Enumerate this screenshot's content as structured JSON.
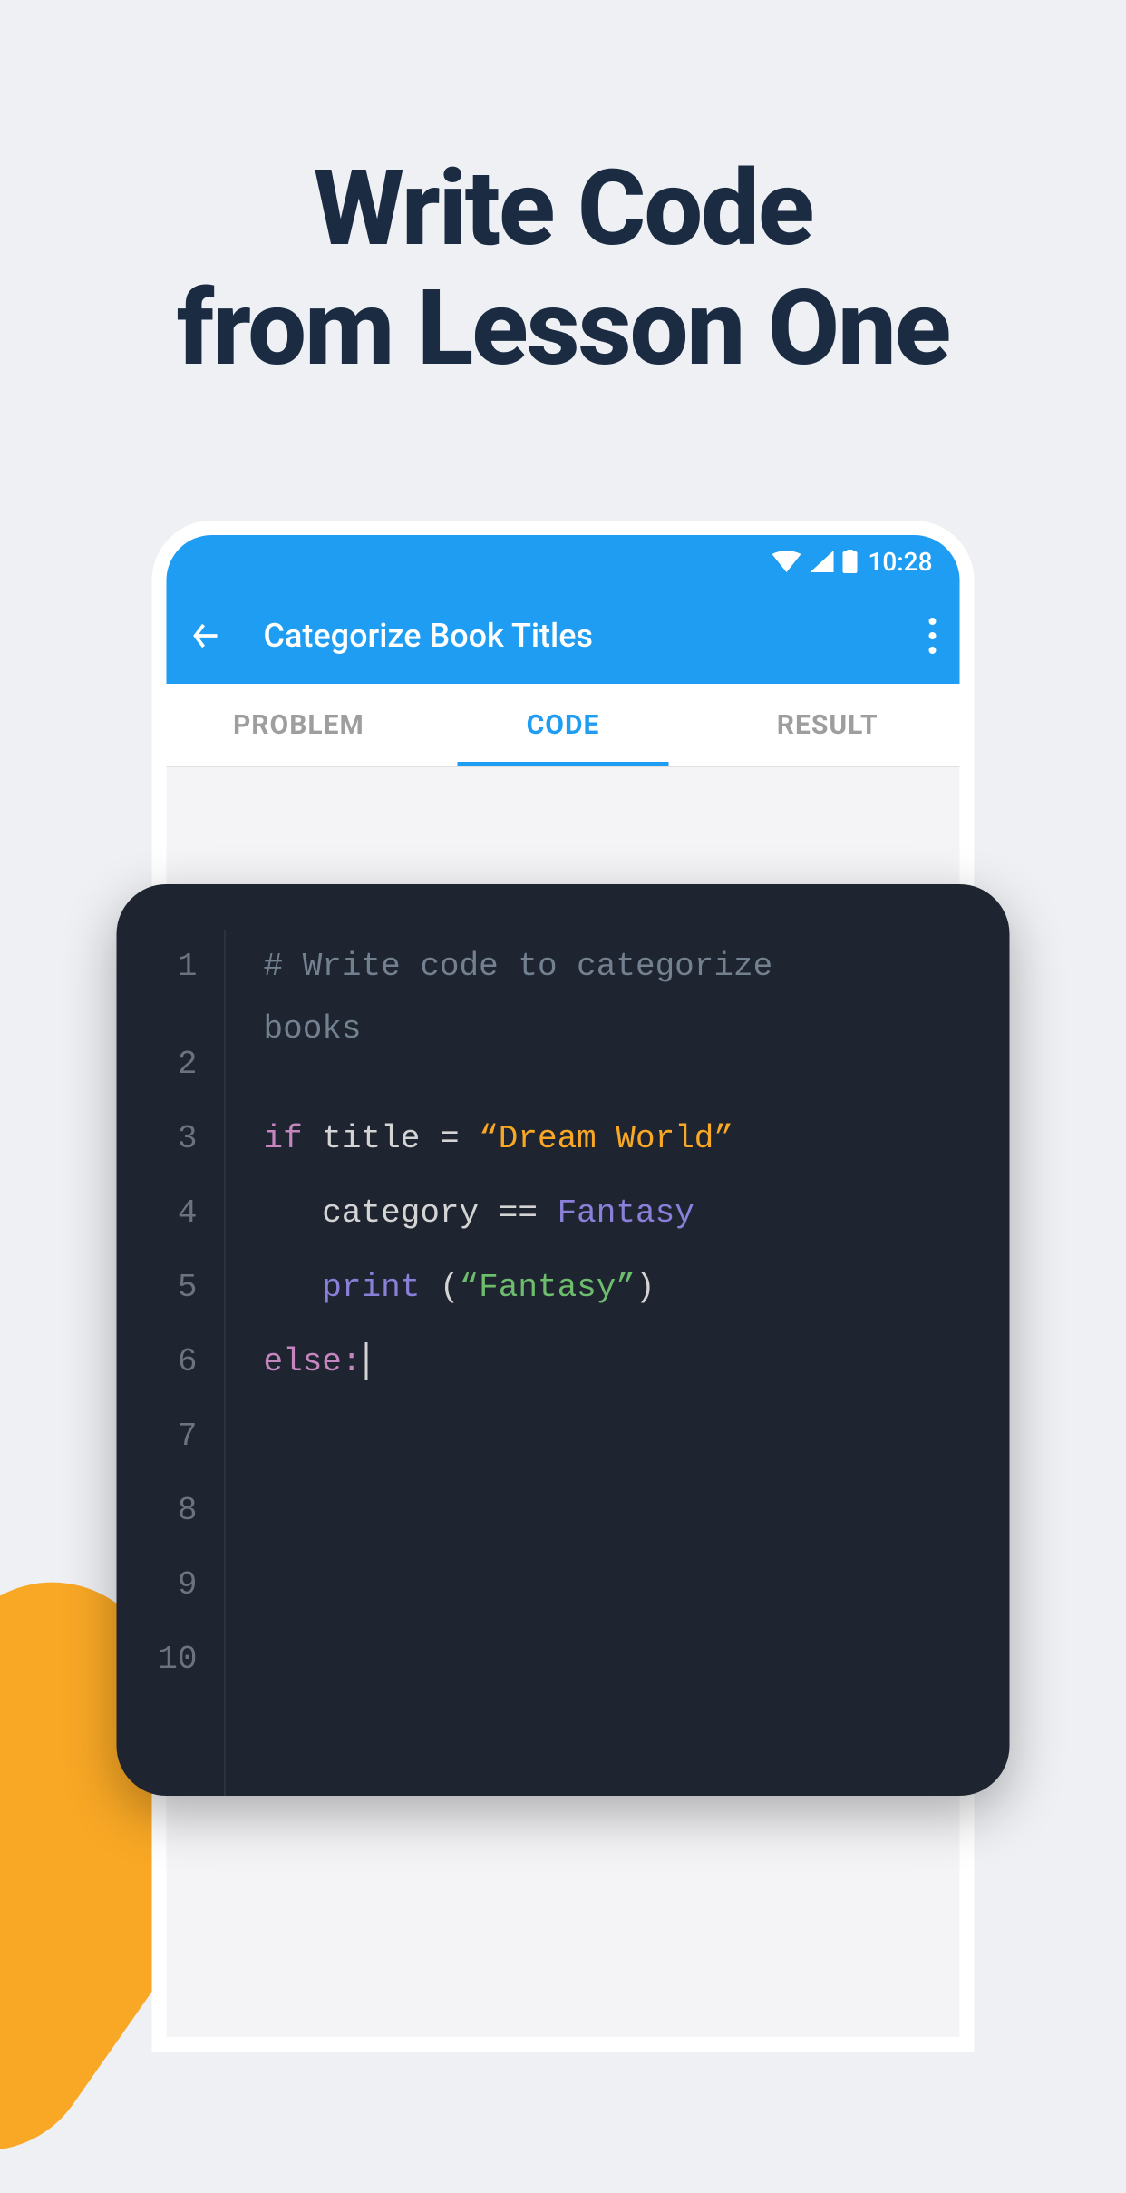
{
  "headline": "Write Code\nfrom Lesson One",
  "statusBar": {
    "time": "10:28"
  },
  "appBar": {
    "title": "Categorize Book Titles"
  },
  "tabs": {
    "problem": "PROBLEM",
    "code": "CODE",
    "result": "RESULT"
  },
  "editor": {
    "lineNumbers": [
      "1",
      "2",
      "3",
      "4",
      "5",
      "6",
      "7",
      "8",
      "9",
      "10"
    ],
    "code": {
      "line1a": "# Write code to categorize ",
      "line1b": "books",
      "line3_if": "if",
      "line3_var": " title = ",
      "line3_str": "“Dream World”",
      "line4_cat": "   category ",
      "line4_eq": "==",
      "line4_fan": " Fantasy",
      "line5_print": "   print ",
      "line5_paren_open": "(",
      "line5_str": "“Fantasy”",
      "line5_paren_close": ")",
      "line6_else": "else:"
    }
  }
}
